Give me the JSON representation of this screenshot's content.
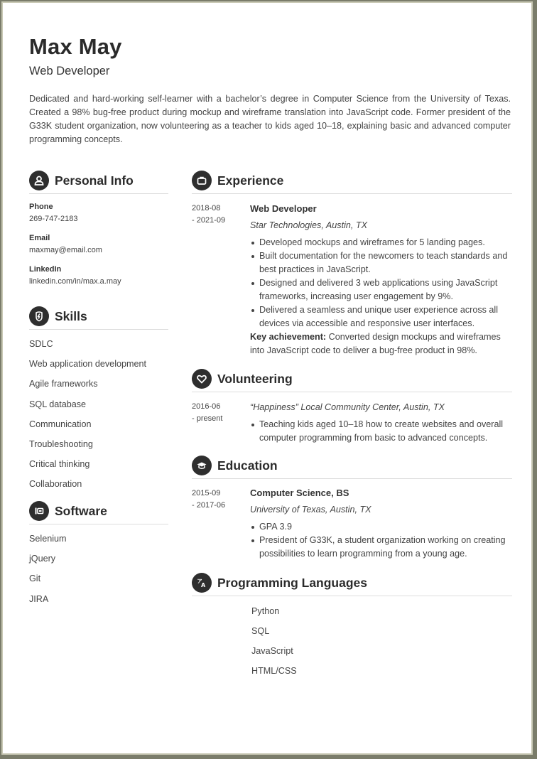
{
  "header": {
    "name": "Max May",
    "title": "Web Developer",
    "summary": "Dedicated and hard-working self-learner with a bachelor’s degree in Computer Science from the University of Texas. Created a 98% bug-free product during mockup and wireframe translation into JavaScript code. Former president of the G33K student organization, now volunteering as a teacher to kids aged 10–18, explaining basic and advanced computer programming concepts."
  },
  "personal_info": {
    "heading": "Personal Info",
    "icon": "user-icon",
    "fields": [
      {
        "label": "Phone",
        "value": "269-747-2183"
      },
      {
        "label": "Email",
        "value": "maxmay@email.com"
      },
      {
        "label": "LinkedIn",
        "value": "linkedin.com/in/max.a.may"
      }
    ]
  },
  "skills": {
    "heading": "Skills",
    "icon": "lightning-shield-icon",
    "items": [
      "SDLC",
      "Web application development",
      "Agile frameworks",
      "SQL database",
      "Communication",
      "Troubleshooting",
      "Critical thinking",
      "Collaboration"
    ]
  },
  "software": {
    "heading": "Software",
    "icon": "software-icon",
    "items": [
      "Selenium",
      "jQuery",
      "Git",
      "JIRA"
    ]
  },
  "experience": {
    "heading": "Experience",
    "icon": "briefcase-icon",
    "entries": [
      {
        "date_start": "2018-08",
        "date_end": "- 2021-09",
        "title": "Web Developer",
        "org": "Star Technologies, Austin, TX",
        "bullets": [
          "Developed mockups and wireframes for 5 landing pages.",
          "Built documentation for the newcomers to teach standards and best practices in JavaScript.",
          "Designed and delivered 3 web applications using JavaScript frameworks, increasing user engagement by 9%.",
          "Delivered a seamless and unique user experience across all devices via accessible and responsive user interfaces."
        ],
        "key_label": "Key achievement:",
        "key_text": " Converted design mockups and wireframes into JavaScript code to deliver a bug-free product in 98%."
      }
    ]
  },
  "volunteering": {
    "heading": "Volunteering",
    "icon": "heart-icon",
    "entries": [
      {
        "date_start": "2016-06",
        "date_end": "- present",
        "org": "“Happiness” Local Community Center, Austin, TX",
        "bullets": [
          "Teaching kids aged 10–18 how to create websites and overall computer programming from basic to advanced concepts."
        ]
      }
    ]
  },
  "education": {
    "heading": "Education",
    "icon": "graduation-cap-icon",
    "entries": [
      {
        "date_start": "2015-09",
        "date_end": "- 2017-06",
        "title": "Computer Science, BS",
        "org": "University of Texas, Austin, TX",
        "bullets": [
          "GPA 3.9",
          "President of G33K, a student organization working on creating possibilities to learn programming from a young age."
        ]
      }
    ]
  },
  "languages": {
    "heading": "Programming Languages",
    "icon": "translate-icon",
    "items": [
      "Python",
      "SQL",
      "JavaScript",
      "HTML/CSS"
    ]
  }
}
